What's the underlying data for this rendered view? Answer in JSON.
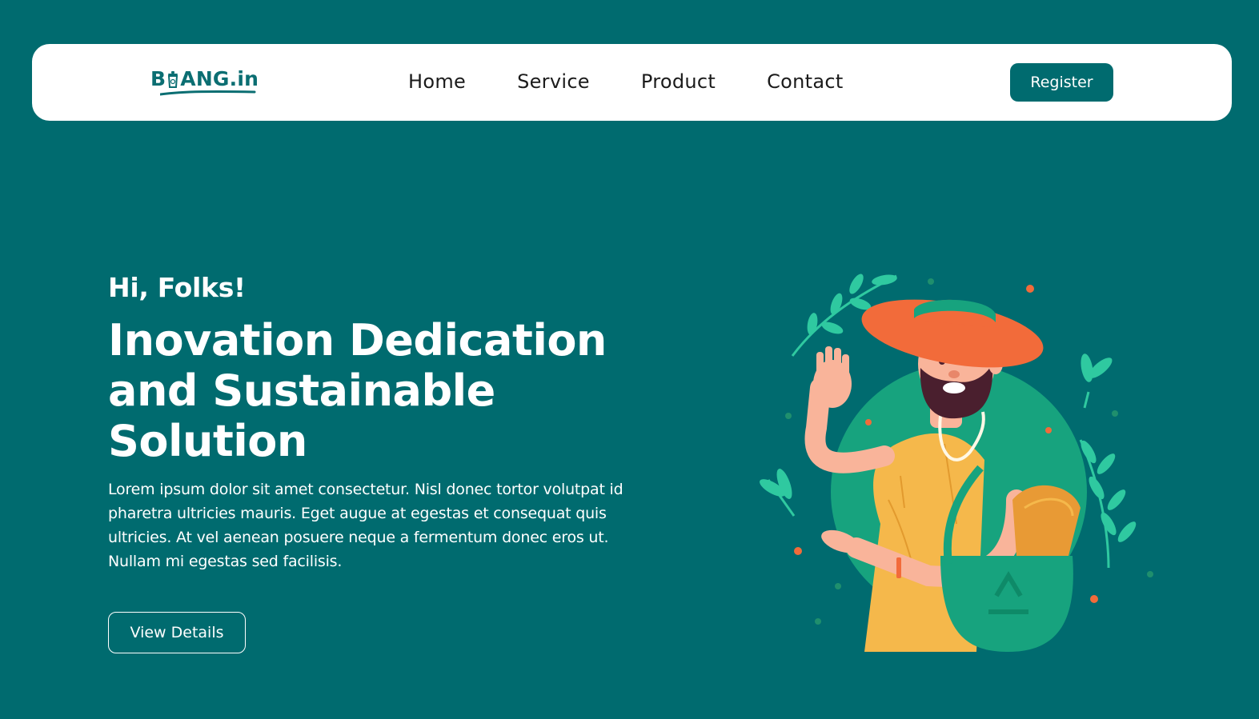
{
  "navbar": {
    "logo": {
      "before": "B",
      "after": "ANG.in"
    },
    "links": [
      "Home",
      "Service",
      "Product",
      "Contact"
    ],
    "register_label": "Register"
  },
  "hero": {
    "greeting": "Hi, Folks!",
    "headline_line1": "Inovation Dedication",
    "headline_line2": "and Sustainable",
    "headline_line3": "Solution",
    "description": "Lorem ipsum dolor sit amet consectetur. Nisl donec tortor volutpat id pharetra ultricies mauris. Eget augue at egestas et consequat quis ultricies. At vel aenean posuere neque a fermentum donec eros ut. Nullam mi egestas sed facilisis.",
    "button_label": "View Details"
  },
  "colors": {
    "background": "#006b6f",
    "navbar": "#ffffff",
    "accent": "#006b6f",
    "illustration_green": "#17a37e",
    "illustration_orange": "#f26b3a",
    "illustration_yellow": "#f5b84b"
  },
  "icons": {
    "logo_bin": "recycle-bin-icon",
    "illustration": "farmer-with-recycle-bag-illustration"
  }
}
